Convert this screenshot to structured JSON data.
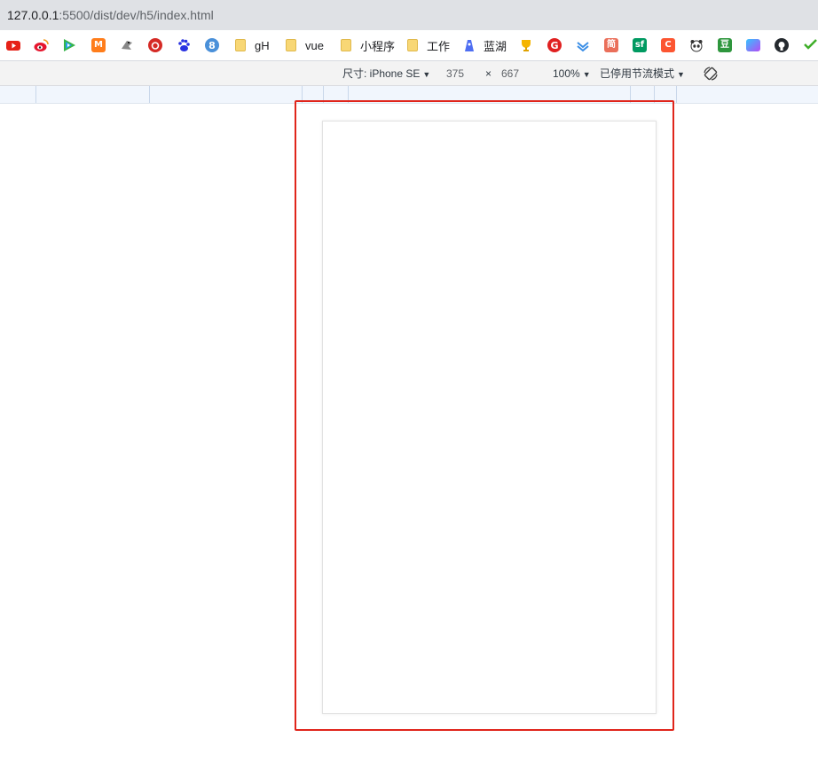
{
  "address_bar": {
    "host": "127.0.0.1",
    "path": ":5500/dist/dev/h5/index.html"
  },
  "bookmarks": [
    {
      "icon": "youtube-icon",
      "label": "",
      "color": "#e62117"
    },
    {
      "icon": "weibo-icon",
      "label": "",
      "color": "#e6162d"
    },
    {
      "icon": "tencent-video-icon",
      "label": "",
      "color": "#35b449"
    },
    {
      "icon": "mango-tv-icon",
      "label": "",
      "color": "#ff7d1b"
    },
    {
      "icon": "bird-icon",
      "label": "",
      "color": "#777777"
    },
    {
      "icon": "netease-music-icon",
      "label": "",
      "color": "#d52a25"
    },
    {
      "icon": "baidu-icon",
      "label": "",
      "color": "#2932e1"
    },
    {
      "icon": "eight-icon",
      "label": "",
      "color": "#4a90d9"
    },
    {
      "icon": "folder-icon",
      "label": "gH"
    },
    {
      "icon": "folder-icon",
      "label": "vue"
    },
    {
      "icon": "folder-icon",
      "label": "小程序"
    },
    {
      "icon": "folder-icon",
      "label": "工作"
    },
    {
      "icon": "lanhu-icon",
      "label": "蓝湖",
      "color": "#4e6ef2"
    },
    {
      "icon": "trophy-icon",
      "label": "",
      "color": "#f5b400"
    },
    {
      "icon": "g-circle-icon",
      "label": "",
      "color": "#e02020"
    },
    {
      "icon": "layers-icon",
      "label": "",
      "color": "#3a8ee6"
    },
    {
      "icon": "jianshu-icon",
      "label": "",
      "color": "#ea6f5a",
      "glyph": "简"
    },
    {
      "icon": "segmentfault-icon",
      "label": "",
      "color": "#009a61",
      "glyph": "sf"
    },
    {
      "icon": "c-icon",
      "label": "",
      "color": "#fc5531",
      "glyph": "C"
    },
    {
      "icon": "panda-icon",
      "label": "",
      "color": "#333333"
    },
    {
      "icon": "douban-icon",
      "label": "",
      "color": "#2e963d",
      "glyph": "豆"
    },
    {
      "icon": "iconfont-icon",
      "label": "",
      "color": "#8a5cf5"
    },
    {
      "icon": "github-icon",
      "label": "",
      "color": "#24292e"
    },
    {
      "icon": "hao-icon",
      "label": "",
      "color": "#3fae29"
    }
  ],
  "device_toolbar": {
    "dimensions_label": "尺寸: iPhone SE",
    "width": "375",
    "times": "×",
    "height": "667",
    "zoom": "100%",
    "throttle": "已停用节流模式"
  },
  "colors": {
    "highlight_border": "#e0251b"
  }
}
